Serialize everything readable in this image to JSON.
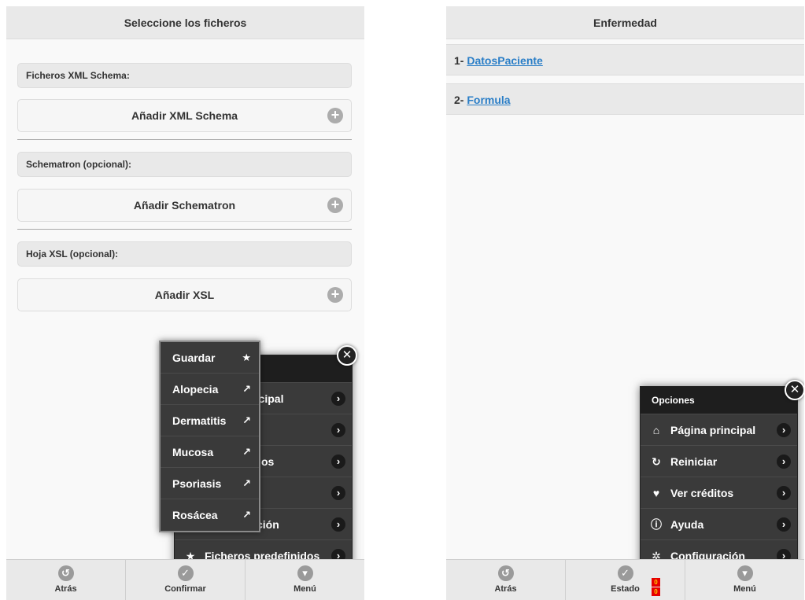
{
  "left": {
    "header": "Seleccione los ficheros",
    "sections": [
      {
        "label": "Ficheros XML Schema:",
        "button": "Añadir XML Schema"
      },
      {
        "label": "Schematron (opcional):",
        "button": "Añadir Schematron"
      },
      {
        "label": "Hoja XSL (opcional):",
        "button": "Añadir XSL"
      }
    ],
    "menu": {
      "items": [
        {
          "label": "Página principal",
          "visible": "ncipal"
        },
        {
          "label": "",
          "visible": ""
        },
        {
          "label": "",
          "visible": "os"
        },
        {
          "label": "",
          "visible": ""
        },
        {
          "label": "",
          "visible": "ción"
        },
        {
          "label": "Ficheros predefinidos",
          "visible": "Ficheros predefinidos"
        }
      ]
    },
    "popup": [
      {
        "label": "Guardar",
        "icon": "star-icon"
      },
      {
        "label": "Alopecia",
        "icon": "external-link-icon"
      },
      {
        "label": "Dermatitis",
        "icon": "external-link-icon"
      },
      {
        "label": "Mucosa",
        "icon": "external-link-icon"
      },
      {
        "label": "Psoriasis",
        "icon": "external-link-icon"
      },
      {
        "label": "Rosácea",
        "icon": "external-link-icon"
      }
    ],
    "footer": [
      {
        "label": "Atrás",
        "icon": "back-icon"
      },
      {
        "label": "Confirmar",
        "icon": "check-icon"
      },
      {
        "label": "Menú",
        "icon": "menu-arrow-icon"
      }
    ]
  },
  "right": {
    "header": "Enfermedad",
    "items": [
      {
        "num": "1-",
        "link": "DatosPaciente"
      },
      {
        "num": "2-",
        "link": "Formula"
      }
    ],
    "menu": {
      "title": "Opciones",
      "items": [
        {
          "label": "Página principal",
          "icon": "home-icon"
        },
        {
          "label": "Reiniciar",
          "icon": "refresh-icon"
        },
        {
          "label": "Ver créditos",
          "icon": "heart-icon"
        },
        {
          "label": "Ayuda",
          "icon": "info-icon"
        },
        {
          "label": "Configuración",
          "icon": "gear-icon"
        }
      ]
    },
    "footer": [
      {
        "label": "Atrás",
        "icon": "back-icon"
      },
      {
        "label": "Estado",
        "icon": "check-icon",
        "badges": [
          "0",
          "0"
        ]
      },
      {
        "label": "Menú",
        "icon": "menu-arrow-icon"
      }
    ]
  },
  "colors": {
    "accent_link": "#2a7ec7",
    "menu_bg": "#333333",
    "badge_bg": "#e60000"
  }
}
